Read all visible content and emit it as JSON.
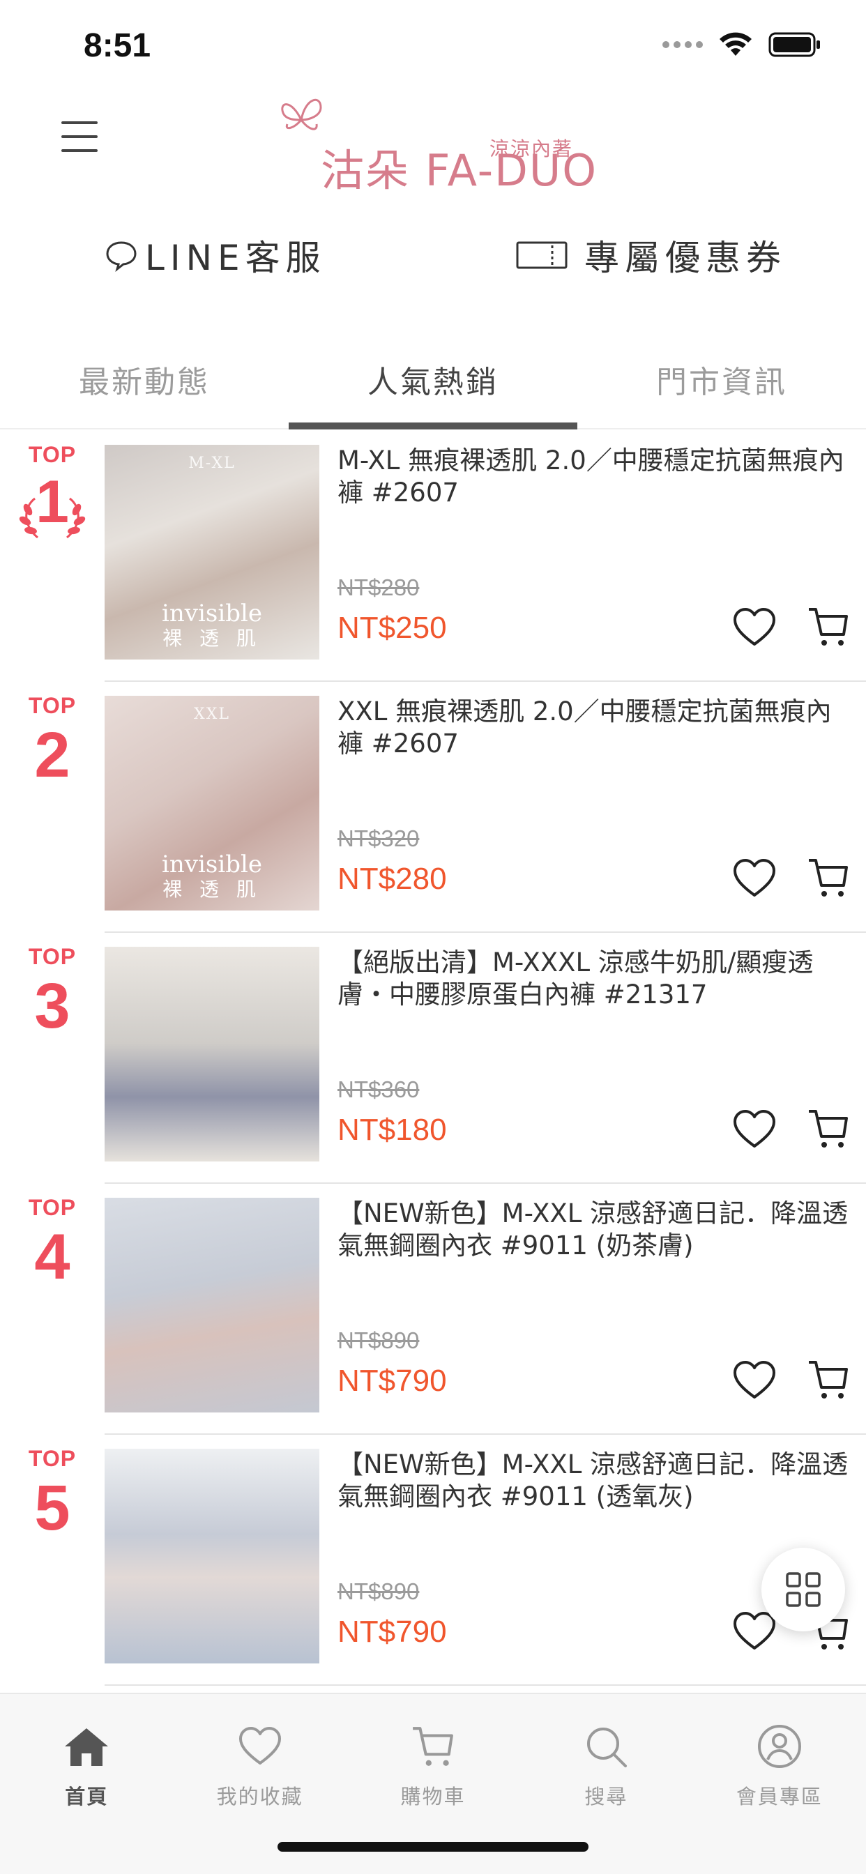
{
  "status_bar": {
    "time": "8:51"
  },
  "header": {
    "brand": "沽朵 FA-DUO",
    "brand_sub": "涼涼內著"
  },
  "actions": {
    "line_service": "LINE客服",
    "coupon": "專屬優惠券"
  },
  "tabs": [
    {
      "label": "最新動態"
    },
    {
      "label": "人氣熱銷"
    },
    {
      "label": "門市資訊"
    }
  ],
  "products": [
    {
      "rank_label": "TOP",
      "rank": "1",
      "title": "M-XL 無痕裸透肌 2.0／中腰穩定抗菌無痕內褲 #2607",
      "price_original": "NT$280",
      "price_sale": "NT$250",
      "thumb_caption": "invisible",
      "thumb_caption_sub": "裸 透 肌",
      "thumb_size": "M-XL"
    },
    {
      "rank_label": "TOP",
      "rank": "2",
      "title": "XXL 無痕裸透肌 2.0／中腰穩定抗菌無痕內褲 #2607",
      "price_original": "NT$320",
      "price_sale": "NT$280",
      "thumb_caption": "invisible",
      "thumb_caption_sub": "裸 透 肌",
      "thumb_size": "XXL"
    },
    {
      "rank_label": "TOP",
      "rank": "3",
      "title": "【絕版出清】M-XXXL 涼感牛奶肌/顯瘦透膚・中腰膠原蛋白內褲 #21317",
      "price_original": "NT$360",
      "price_sale": "NT$180"
    },
    {
      "rank_label": "TOP",
      "rank": "4",
      "title": "【NEW新色】M-XXL 涼感舒適日記．降溫透氣無鋼圈內衣 #9011 (奶茶膚)",
      "price_original": "NT$890",
      "price_sale": "NT$790"
    },
    {
      "rank_label": "TOP",
      "rank": "5",
      "title": "【NEW新色】M-XXL 涼感舒適日記．降溫透氣無鋼圈內衣 #9011 (透氧灰)",
      "price_original": "NT$890",
      "price_sale": "NT$790"
    }
  ],
  "bottom_nav": [
    {
      "label": "首頁",
      "icon": "home-icon"
    },
    {
      "label": "我的收藏",
      "icon": "heart-icon"
    },
    {
      "label": "購物車",
      "icon": "cart-icon"
    },
    {
      "label": "搜尋",
      "icon": "search-icon"
    },
    {
      "label": "會員專區",
      "icon": "user-icon"
    }
  ],
  "colors": {
    "brand_pink": "#d67c8b",
    "rank_red": "#ee4e5c",
    "sale_orange": "#f0562d"
  }
}
